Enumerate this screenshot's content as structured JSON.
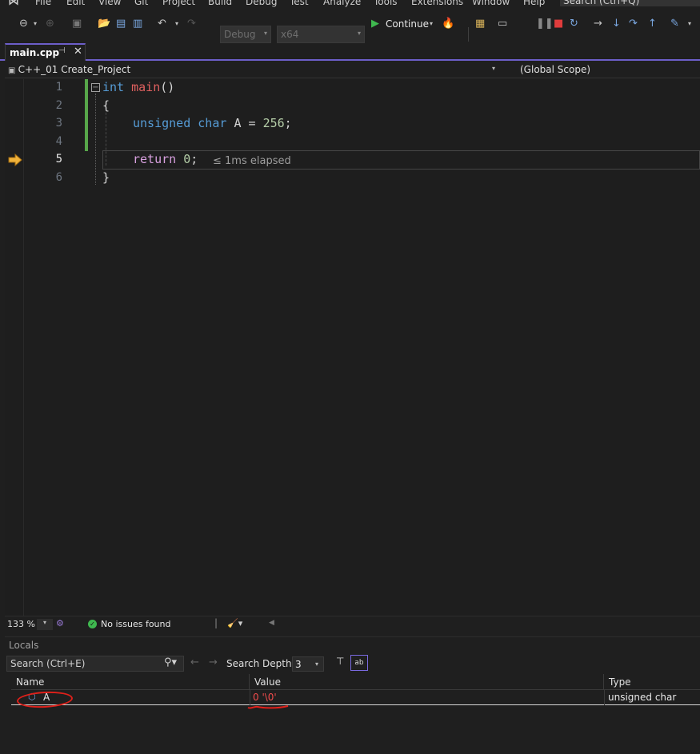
{
  "menu": {
    "items": [
      "File",
      "Edit",
      "View",
      "Git",
      "Project",
      "Build",
      "Debug",
      "Test",
      "Analyze",
      "Tools",
      "Extensions",
      "Window",
      "Help"
    ],
    "search_placeholder": "Search (Ctrl+Q)"
  },
  "toolbar": {
    "configuration": "Debug",
    "platform": "x64",
    "continue_label": "Continue"
  },
  "tab": {
    "label": "main.cpp"
  },
  "navbar": {
    "project": "C++_01 Create_Project",
    "scope": "(Global Scope)"
  },
  "editor": {
    "line_numbers": [
      "1",
      "2",
      "3",
      "4",
      "5",
      "6"
    ],
    "current_line": "5",
    "elapsed": "≤ 1ms elapsed",
    "code": {
      "l1_kw": "int",
      "l1_fn": "main",
      "l1_rest": "()",
      "l2": "{",
      "l3_kw": "unsigned char",
      "l3_var": "A =",
      "l3_num": "256",
      "l3_end": ";",
      "l5_kw": "return",
      "l5_num": "0",
      "l5_end": ";",
      "l6": "}"
    }
  },
  "status": {
    "zoom": "133 %",
    "issues": "No issues found"
  },
  "locals": {
    "title": "Locals",
    "search_placeholder": "Search (Ctrl+E)",
    "search_depth_label": "Search Depth:",
    "search_depth_value": "3",
    "columns": [
      "Name",
      "Value",
      "Type"
    ],
    "rows": [
      {
        "name": "A",
        "value": "0 '\\0'",
        "type": "unsigned char"
      }
    ]
  },
  "colors": {
    "accent": "#6c5ec9",
    "keyword": "#569cd6",
    "function": "#e0605f",
    "number": "#b5cea8",
    "control": "#d8a0df",
    "changed_value": "#f14c4c",
    "annotation": "#e0201a"
  }
}
